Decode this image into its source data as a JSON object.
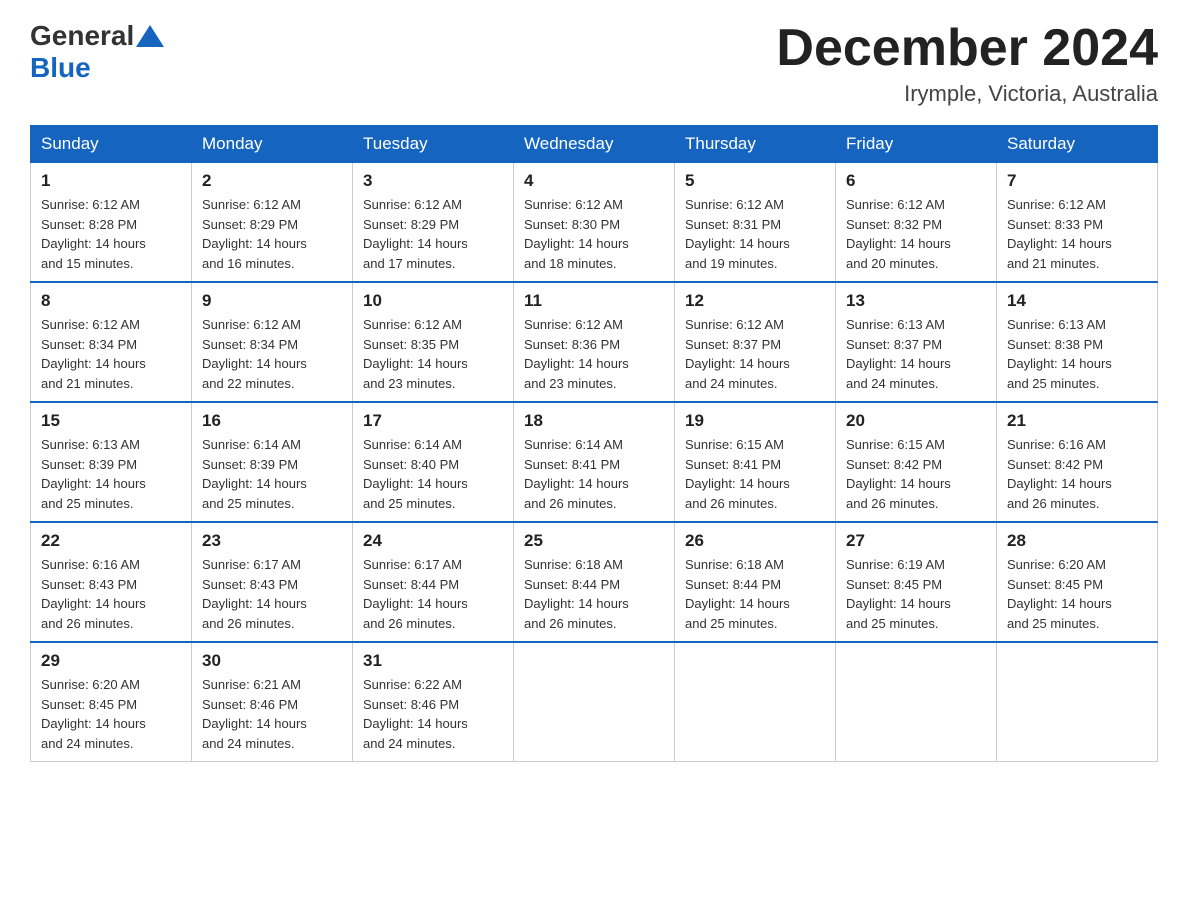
{
  "logo": {
    "general": "General",
    "blue": "Blue"
  },
  "title": "December 2024",
  "location": "Irymple, Victoria, Australia",
  "weekdays": [
    "Sunday",
    "Monday",
    "Tuesday",
    "Wednesday",
    "Thursday",
    "Friday",
    "Saturday"
  ],
  "weeks": [
    [
      {
        "day": "1",
        "sunrise": "6:12 AM",
        "sunset": "8:28 PM",
        "daylight": "14 hours and 15 minutes."
      },
      {
        "day": "2",
        "sunrise": "6:12 AM",
        "sunset": "8:29 PM",
        "daylight": "14 hours and 16 minutes."
      },
      {
        "day": "3",
        "sunrise": "6:12 AM",
        "sunset": "8:29 PM",
        "daylight": "14 hours and 17 minutes."
      },
      {
        "day": "4",
        "sunrise": "6:12 AM",
        "sunset": "8:30 PM",
        "daylight": "14 hours and 18 minutes."
      },
      {
        "day": "5",
        "sunrise": "6:12 AM",
        "sunset": "8:31 PM",
        "daylight": "14 hours and 19 minutes."
      },
      {
        "day": "6",
        "sunrise": "6:12 AM",
        "sunset": "8:32 PM",
        "daylight": "14 hours and 20 minutes."
      },
      {
        "day": "7",
        "sunrise": "6:12 AM",
        "sunset": "8:33 PM",
        "daylight": "14 hours and 21 minutes."
      }
    ],
    [
      {
        "day": "8",
        "sunrise": "6:12 AM",
        "sunset": "8:34 PM",
        "daylight": "14 hours and 21 minutes."
      },
      {
        "day": "9",
        "sunrise": "6:12 AM",
        "sunset": "8:34 PM",
        "daylight": "14 hours and 22 minutes."
      },
      {
        "day": "10",
        "sunrise": "6:12 AM",
        "sunset": "8:35 PM",
        "daylight": "14 hours and 23 minutes."
      },
      {
        "day": "11",
        "sunrise": "6:12 AM",
        "sunset": "8:36 PM",
        "daylight": "14 hours and 23 minutes."
      },
      {
        "day": "12",
        "sunrise": "6:12 AM",
        "sunset": "8:37 PM",
        "daylight": "14 hours and 24 minutes."
      },
      {
        "day": "13",
        "sunrise": "6:13 AM",
        "sunset": "8:37 PM",
        "daylight": "14 hours and 24 minutes."
      },
      {
        "day": "14",
        "sunrise": "6:13 AM",
        "sunset": "8:38 PM",
        "daylight": "14 hours and 25 minutes."
      }
    ],
    [
      {
        "day": "15",
        "sunrise": "6:13 AM",
        "sunset": "8:39 PM",
        "daylight": "14 hours and 25 minutes."
      },
      {
        "day": "16",
        "sunrise": "6:14 AM",
        "sunset": "8:39 PM",
        "daylight": "14 hours and 25 minutes."
      },
      {
        "day": "17",
        "sunrise": "6:14 AM",
        "sunset": "8:40 PM",
        "daylight": "14 hours and 25 minutes."
      },
      {
        "day": "18",
        "sunrise": "6:14 AM",
        "sunset": "8:41 PM",
        "daylight": "14 hours and 26 minutes."
      },
      {
        "day": "19",
        "sunrise": "6:15 AM",
        "sunset": "8:41 PM",
        "daylight": "14 hours and 26 minutes."
      },
      {
        "day": "20",
        "sunrise": "6:15 AM",
        "sunset": "8:42 PM",
        "daylight": "14 hours and 26 minutes."
      },
      {
        "day": "21",
        "sunrise": "6:16 AM",
        "sunset": "8:42 PM",
        "daylight": "14 hours and 26 minutes."
      }
    ],
    [
      {
        "day": "22",
        "sunrise": "6:16 AM",
        "sunset": "8:43 PM",
        "daylight": "14 hours and 26 minutes."
      },
      {
        "day": "23",
        "sunrise": "6:17 AM",
        "sunset": "8:43 PM",
        "daylight": "14 hours and 26 minutes."
      },
      {
        "day": "24",
        "sunrise": "6:17 AM",
        "sunset": "8:44 PM",
        "daylight": "14 hours and 26 minutes."
      },
      {
        "day": "25",
        "sunrise": "6:18 AM",
        "sunset": "8:44 PM",
        "daylight": "14 hours and 26 minutes."
      },
      {
        "day": "26",
        "sunrise": "6:18 AM",
        "sunset": "8:44 PM",
        "daylight": "14 hours and 25 minutes."
      },
      {
        "day": "27",
        "sunrise": "6:19 AM",
        "sunset": "8:45 PM",
        "daylight": "14 hours and 25 minutes."
      },
      {
        "day": "28",
        "sunrise": "6:20 AM",
        "sunset": "8:45 PM",
        "daylight": "14 hours and 25 minutes."
      }
    ],
    [
      {
        "day": "29",
        "sunrise": "6:20 AM",
        "sunset": "8:45 PM",
        "daylight": "14 hours and 24 minutes."
      },
      {
        "day": "30",
        "sunrise": "6:21 AM",
        "sunset": "8:46 PM",
        "daylight": "14 hours and 24 minutes."
      },
      {
        "day": "31",
        "sunrise": "6:22 AM",
        "sunset": "8:46 PM",
        "daylight": "14 hours and 24 minutes."
      },
      null,
      null,
      null,
      null
    ]
  ]
}
